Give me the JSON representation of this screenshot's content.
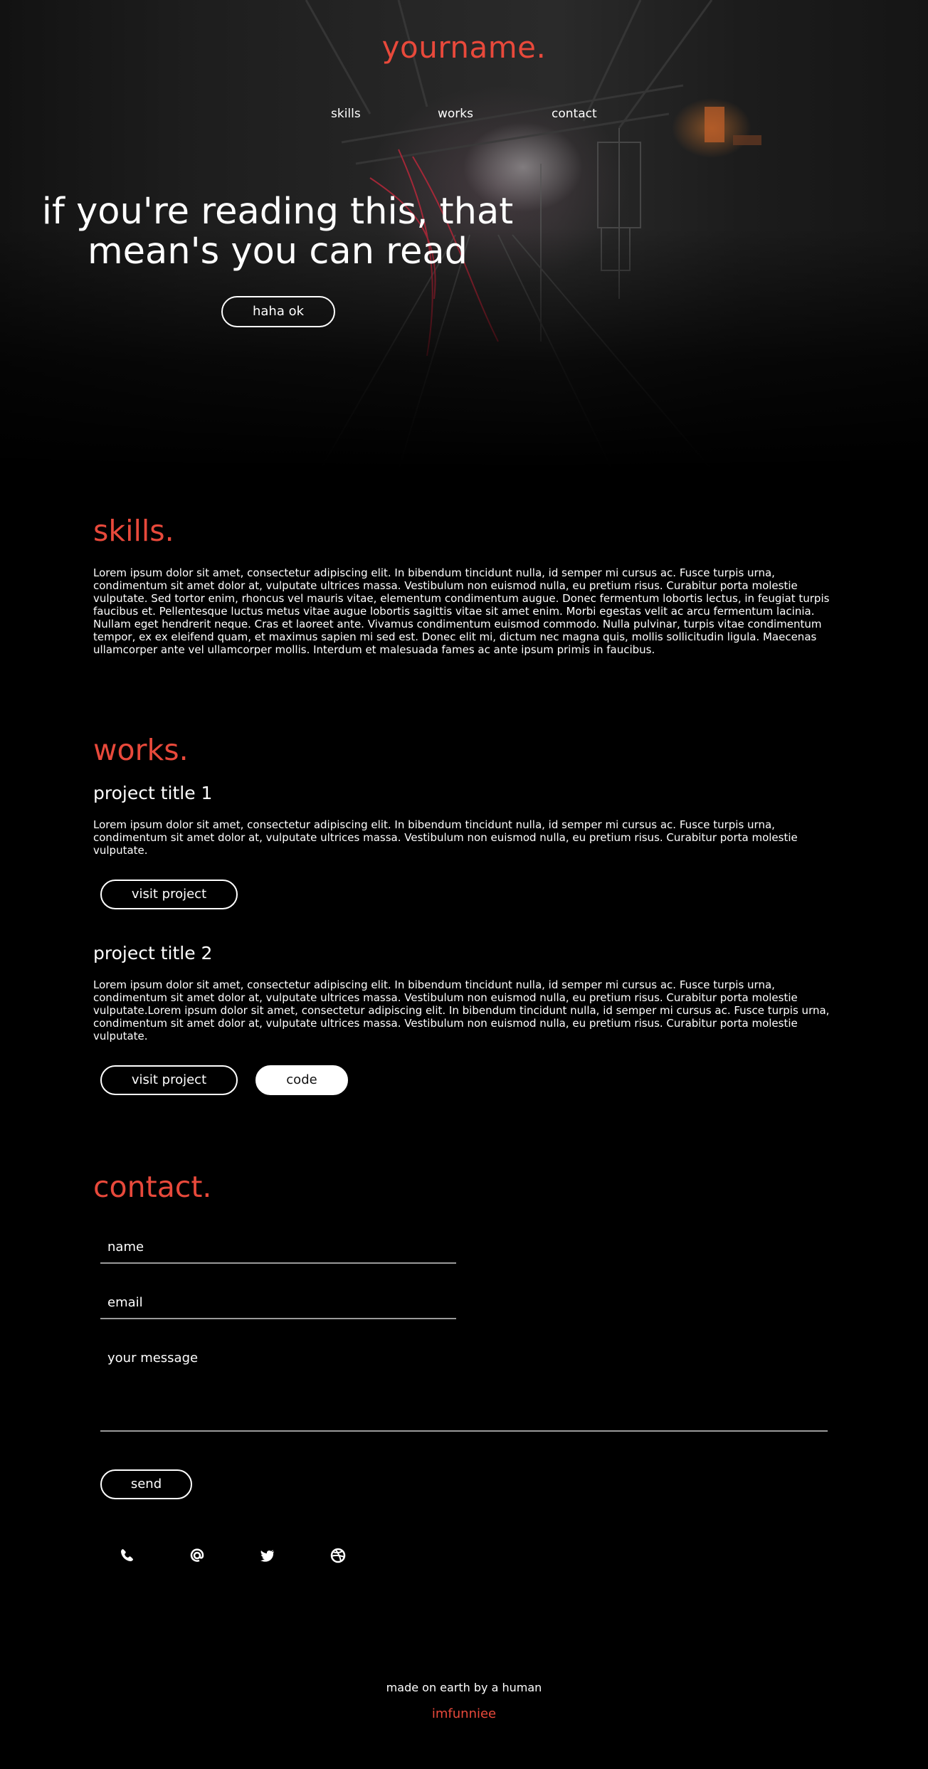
{
  "colors": {
    "accent": "#e8493b",
    "background": "#000000",
    "text": "#ffffff",
    "divider": "#9a9a9a"
  },
  "header": {
    "logo": "yourname.",
    "nav": [
      {
        "label": "skills"
      },
      {
        "label": "works"
      },
      {
        "label": "contact"
      }
    ]
  },
  "hero": {
    "title_line1": "if you're reading this, that",
    "title_line2": "mean's you can read",
    "cta_label": "haha ok"
  },
  "skills": {
    "title": "skills.",
    "body": "Lorem ipsum dolor sit amet, consectetur adipiscing elit. In bibendum tincidunt nulla, id semper mi cursus ac. Fusce turpis urna, condimentum sit amet dolor at, vulputate ultrices massa. Vestibulum non euismod nulla, eu pretium risus. Curabitur porta molestie vulputate. Sed tortor enim, rhoncus vel mauris vitae, elementum condimentum augue. Donec fermentum lobortis lectus, in feugiat turpis faucibus et. Pellentesque luctus metus vitae augue lobortis sagittis vitae sit amet enim. Morbi egestas velit ac arcu fermentum lacinia. Nullam eget hendrerit neque. Cras et laoreet ante. Vivamus condimentum euismod commodo. Nulla pulvinar, turpis vitae condimentum tempor, ex ex eleifend quam, et maximus sapien mi sed est. Donec elit mi, dictum nec magna quis, mollis sollicitudin ligula. Maecenas ullamcorper ante vel ullamcorper mollis. Interdum et malesuada fames ac ante ipsum primis in faucibus."
  },
  "works": {
    "title": "works.",
    "projects": [
      {
        "title": "project title 1",
        "description": "Lorem ipsum dolor sit amet, consectetur adipiscing elit. In bibendum tincidunt nulla, id semper mi cursus ac. Fusce turpis urna, condimentum sit amet dolor at, vulputate ultrices massa. Vestibulum non euismod nulla, eu pretium risus. Curabitur porta molestie vulputate.",
        "visit_label": "visit project"
      },
      {
        "title": "project title 2",
        "description": "Lorem ipsum dolor sit amet, consectetur adipiscing elit. In bibendum tincidunt nulla, id semper mi cursus ac. Fusce turpis urna, condimentum sit amet dolor at, vulputate ultrices massa. Vestibulum non euismod nulla, eu pretium risus. Curabitur porta molestie vulputate.Lorem ipsum dolor sit amet, consectetur adipiscing elit. In bibendum tincidunt nulla, id semper mi cursus ac. Fusce turpis urna, condimentum sit amet dolor at, vulputate ultrices massa. Vestibulum non euismod nulla, eu pretium risus. Curabitur porta molestie vulputate.",
        "visit_label": "visit project",
        "code_label": "code"
      }
    ]
  },
  "contact": {
    "title": "contact.",
    "name_placeholder": "name",
    "email_placeholder": "email",
    "message_placeholder": "your message",
    "send_label": "send",
    "social_icons": [
      "phone-icon",
      "at-icon",
      "twitter-icon",
      "dribbble-icon"
    ]
  },
  "footer": {
    "tagline": "made on earth by a human",
    "author": "imfunniee"
  }
}
